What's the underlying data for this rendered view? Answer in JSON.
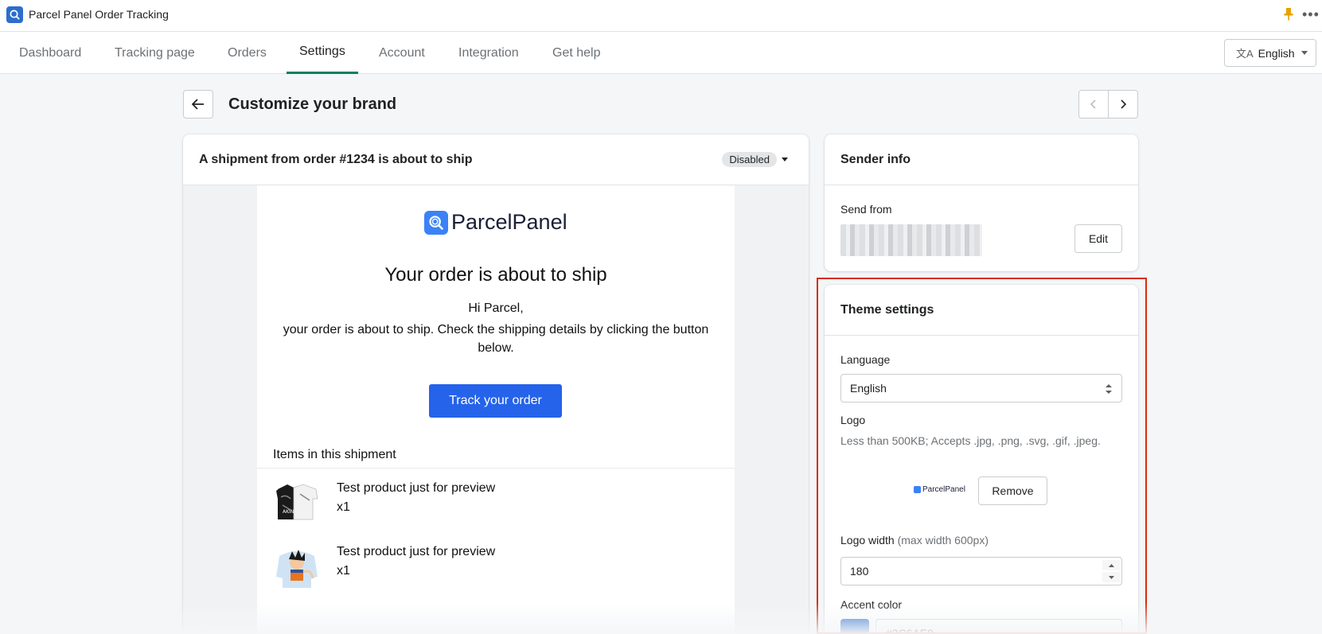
{
  "app": {
    "title": "Parcel Panel Order Tracking",
    "accent": "#008060"
  },
  "nav": {
    "tabs": [
      {
        "label": "Dashboard"
      },
      {
        "label": "Tracking page"
      },
      {
        "label": "Orders"
      },
      {
        "label": "Settings",
        "active": true
      },
      {
        "label": "Account"
      },
      {
        "label": "Integration"
      },
      {
        "label": "Get help"
      }
    ],
    "language_button": "English"
  },
  "page": {
    "title": "Customize your brand"
  },
  "email_card": {
    "title": "A shipment from order #1234 is about to ship",
    "status": "Disabled",
    "preview": {
      "logo_text": "ParcelPanel",
      "heading": "Your order is about to ship",
      "greeting": "Hi Parcel,",
      "text": "your order is about to ship. Check the shipping details by clicking the button below.",
      "button_label": "Track your order",
      "button_color": "#2563eb",
      "items_heading": "Items in this shipment",
      "items": [
        {
          "name": "Test product just for preview",
          "qty": "x1"
        },
        {
          "name": "Test product just for preview",
          "qty": "x1"
        }
      ]
    }
  },
  "sender_info": {
    "title": "Sender info",
    "send_from_label": "Send from",
    "edit_label": "Edit"
  },
  "theme_settings": {
    "title": "Theme settings",
    "language_label": "Language",
    "language_value": "English",
    "logo_label": "Logo",
    "logo_help": "Less than 500KB; Accepts .jpg, .png, .svg, .gif, .jpeg.",
    "logo_preview_text": "ParcelPanel",
    "remove_label": "Remove",
    "logo_width_label": "Logo width",
    "logo_width_hint": "(max width 600px)",
    "logo_width_value": "180",
    "accent_color_label": "Accent color",
    "accent_color_value": "#2C6AE0",
    "accent_color_swatch": "#2c6ecb"
  }
}
